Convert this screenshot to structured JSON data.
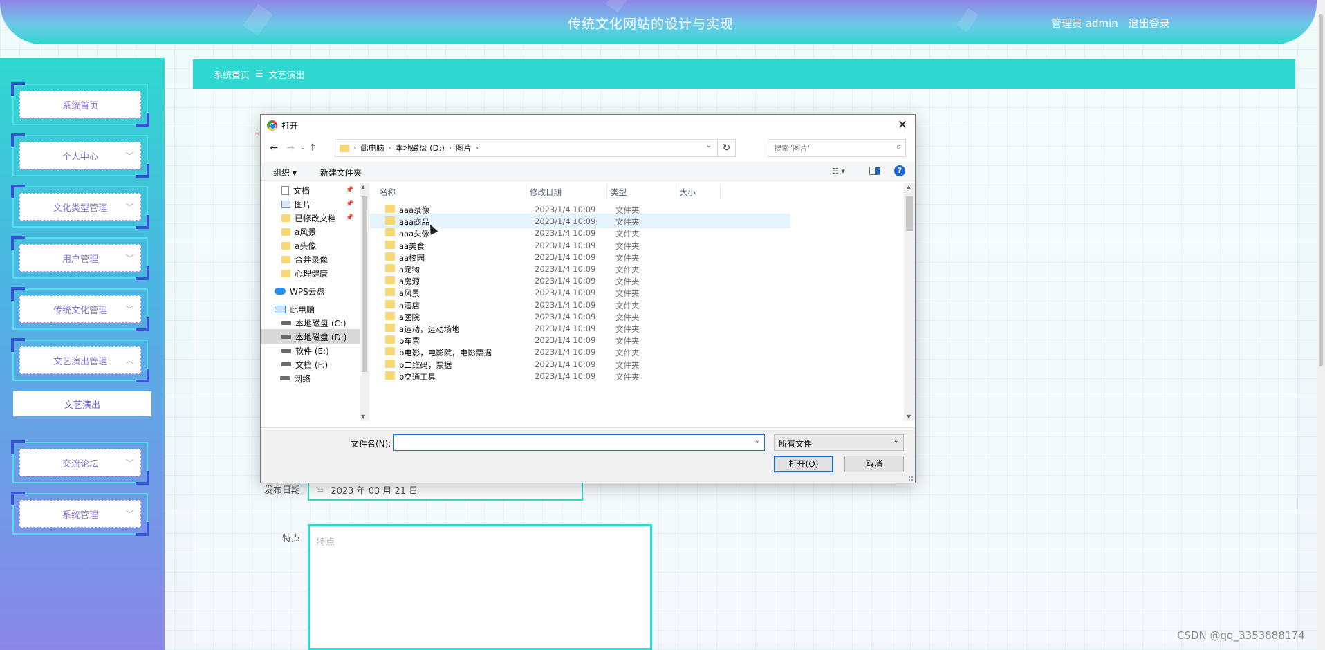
{
  "header": {
    "title": "传统文化网站的设计与实现",
    "user_label": "管理员 admin",
    "logout_label": "退出登录"
  },
  "sidebar": {
    "items": [
      {
        "label": "系统首页",
        "has_chevron": false
      },
      {
        "label": "个人中心",
        "has_chevron": true
      },
      {
        "label": "文化类型管理",
        "has_chevron": true
      },
      {
        "label": "用户管理",
        "has_chevron": true
      },
      {
        "label": "传统文化管理",
        "has_chevron": true
      },
      {
        "label": "文艺演出管理",
        "has_chevron": true,
        "expanded": true
      },
      {
        "label": "交流论坛",
        "has_chevron": true
      },
      {
        "label": "系统管理",
        "has_chevron": true
      }
    ],
    "sub_item": "文艺演出",
    "chevron_down": "﹀",
    "chevron_up": "︿"
  },
  "breadcrumb": {
    "home": "系统首页",
    "sep": "☰",
    "current": "文艺演出"
  },
  "form": {
    "required_mark": "*",
    "publish_date_label": "发布日期",
    "publish_date_value": "2023 年 03 月 21 日",
    "feature_label": "特点",
    "feature_placeholder": "特点"
  },
  "dialog": {
    "title": "打开",
    "close": "✕",
    "address": {
      "crumbs": [
        "此电脑",
        "本地磁盘 (D:)",
        "图片"
      ],
      "sep": "›"
    },
    "search_placeholder": "搜索\"图片\"",
    "toolbar": {
      "organize": "组织 ▾",
      "new_folder": "新建文件夹",
      "help": "?"
    },
    "nav_pane": [
      {
        "label": "文档",
        "icon": "doc",
        "pinned": true
      },
      {
        "label": "图片",
        "icon": "pic",
        "pinned": true
      },
      {
        "label": "已修改文档",
        "icon": "folder",
        "pinned": true
      },
      {
        "label": "a风景",
        "icon": "folder",
        "pinned": false
      },
      {
        "label": "a头像",
        "icon": "folder",
        "pinned": false
      },
      {
        "label": "合并录像",
        "icon": "folder",
        "pinned": false
      },
      {
        "label": "心理健康",
        "icon": "folder",
        "pinned": false
      },
      {
        "label": "WPS云盘",
        "icon": "cloud",
        "pinned": false
      },
      {
        "label": "此电脑",
        "icon": "pc",
        "pinned": false
      },
      {
        "label": "本地磁盘 (C:)",
        "icon": "drive",
        "pinned": false
      },
      {
        "label": "本地磁盘 (D:)",
        "icon": "drive",
        "pinned": false,
        "selected": true
      },
      {
        "label": "软件 (E:)",
        "icon": "drive",
        "pinned": false
      },
      {
        "label": "文档 (F:)",
        "icon": "drive",
        "pinned": false
      },
      {
        "label": "网络",
        "icon": "drive",
        "pinned": false
      }
    ],
    "columns": {
      "name": "名称",
      "date": "修改日期",
      "type": "类型",
      "size": "大小"
    },
    "files": [
      {
        "name": "aaa录像",
        "date": "2023/1/4 10:09",
        "type": "文件夹"
      },
      {
        "name": "aaa商品",
        "date": "2023/1/4 10:09",
        "type": "文件夹"
      },
      {
        "name": "aaa头像",
        "date": "2023/1/4 10:09",
        "type": "文件夹"
      },
      {
        "name": "aa美食",
        "date": "2023/1/4 10:09",
        "type": "文件夹"
      },
      {
        "name": "aa校园",
        "date": "2023/1/4 10:09",
        "type": "文件夹"
      },
      {
        "name": "a宠物",
        "date": "2023/1/4 10:09",
        "type": "文件夹"
      },
      {
        "name": "a房源",
        "date": "2023/1/4 10:09",
        "type": "文件夹"
      },
      {
        "name": "a风景",
        "date": "2023/1/4 10:09",
        "type": "文件夹"
      },
      {
        "name": "a酒店",
        "date": "2023/1/4 10:09",
        "type": "文件夹"
      },
      {
        "name": "a医院",
        "date": "2023/1/4 10:09",
        "type": "文件夹"
      },
      {
        "name": "a运动，运动场地",
        "date": "2023/1/4 10:09",
        "type": "文件夹"
      },
      {
        "name": "b车票",
        "date": "2023/1/4 10:09",
        "type": "文件夹"
      },
      {
        "name": "b电影，电影院，电影票据",
        "date": "2023/1/4 10:09",
        "type": "文件夹"
      },
      {
        "name": "b二维码，票据",
        "date": "2023/1/4 10:09",
        "type": "文件夹"
      },
      {
        "name": "b交通工具",
        "date": "2023/1/4 10:09",
        "type": "文件夹"
      }
    ],
    "filename_label": "文件名(N):",
    "filename_value": "",
    "filetype_value": "所有文件",
    "open_button": "打开(O)",
    "cancel_button": "取消"
  },
  "watermark": "CSDN @qq_3353888174"
}
